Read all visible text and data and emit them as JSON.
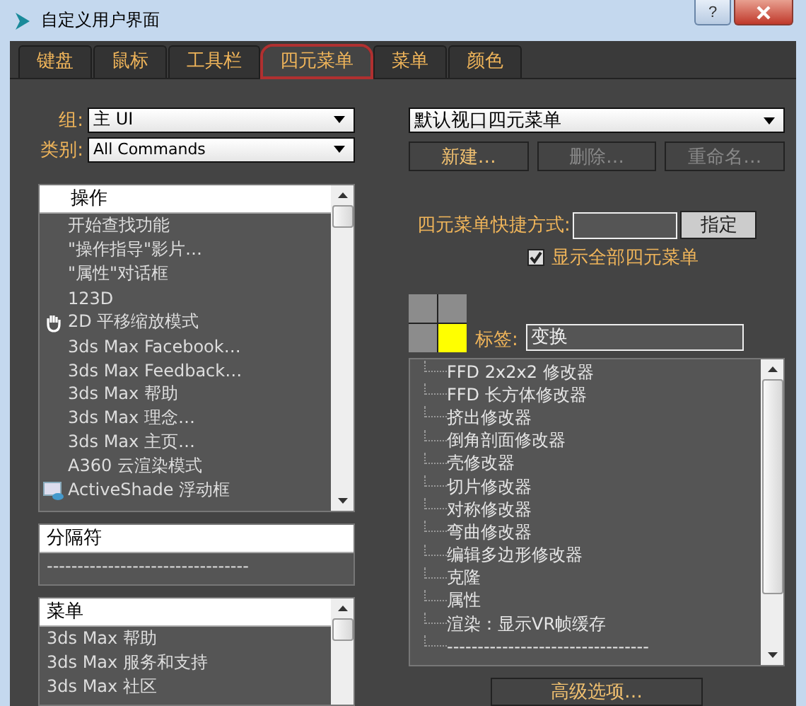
{
  "window": {
    "title": "自定义用户界面"
  },
  "help_button": {
    "label": "?"
  },
  "tabs": [
    {
      "label": "键盘",
      "selected": false
    },
    {
      "label": "鼠标",
      "selected": false
    },
    {
      "label": "工具栏",
      "selected": false
    },
    {
      "label": "四元菜单",
      "selected": true
    },
    {
      "label": "菜单",
      "selected": false
    },
    {
      "label": "颜色",
      "selected": false
    }
  ],
  "group": {
    "label": "组:",
    "value": "主 UI"
  },
  "category": {
    "label": "类别:",
    "value": "All Commands"
  },
  "actions_list": {
    "header": "操作",
    "items": [
      {
        "label": "开始查找功能",
        "kind": "plain"
      },
      {
        "label": "\"操作指导\"影片…",
        "kind": "plain"
      },
      {
        "label": "\"属性\"对话框",
        "kind": "plain"
      },
      {
        "label": "123D",
        "kind": "plain"
      },
      {
        "label": "2D 平移缩放模式",
        "kind": "pan"
      },
      {
        "label": "3ds Max Facebook…",
        "kind": "plain"
      },
      {
        "label": "3ds Max Feedback…",
        "kind": "plain"
      },
      {
        "label": "3ds Max 帮助",
        "kind": "plain"
      },
      {
        "label": "3ds Max 理念…",
        "kind": "plain"
      },
      {
        "label": "3ds Max 主页…",
        "kind": "plain"
      },
      {
        "label": "A360 云渲染模式",
        "kind": "plain"
      },
      {
        "label": "ActiveShade 浮动框",
        "kind": "floater"
      }
    ]
  },
  "separator_list": {
    "header": "分隔符",
    "items": [
      "---------------------------------"
    ]
  },
  "menu_list": {
    "header": "菜单",
    "items": [
      "3ds Max 帮助",
      "3ds Max 服务和支持",
      "3ds Max 社区"
    ]
  },
  "quad_menu": {
    "value": "默认视口四元菜单"
  },
  "quad_buttons": [
    {
      "label": "新建…",
      "disabled": false
    },
    {
      "label": "删除…",
      "disabled": true
    },
    {
      "label": "重命名…",
      "disabled": true
    }
  ],
  "shortcut": {
    "label": "四元菜单快捷方式:",
    "button": "指定"
  },
  "show_all": {
    "label": "显示全部四元菜单",
    "checked": true
  },
  "quadrants": [
    {
      "selected": false
    },
    {
      "selected": false
    },
    {
      "selected": false
    },
    {
      "selected": true
    }
  ],
  "label_field": {
    "label": "标签:",
    "value": "变换"
  },
  "quad_items": [
    "FFD 2x2x2 修改器",
    "FFD 长方体修改器",
    "挤出修改器",
    "倒角剖面修改器",
    "壳修改器",
    "切片修改器",
    "对称修改器",
    "弯曲修改器",
    "编辑多边形修改器",
    "克隆",
    "属性",
    "渲染：显示VR帧缓存",
    "---------------------------------"
  ],
  "advanced_button": {
    "label": "高级选项…"
  }
}
